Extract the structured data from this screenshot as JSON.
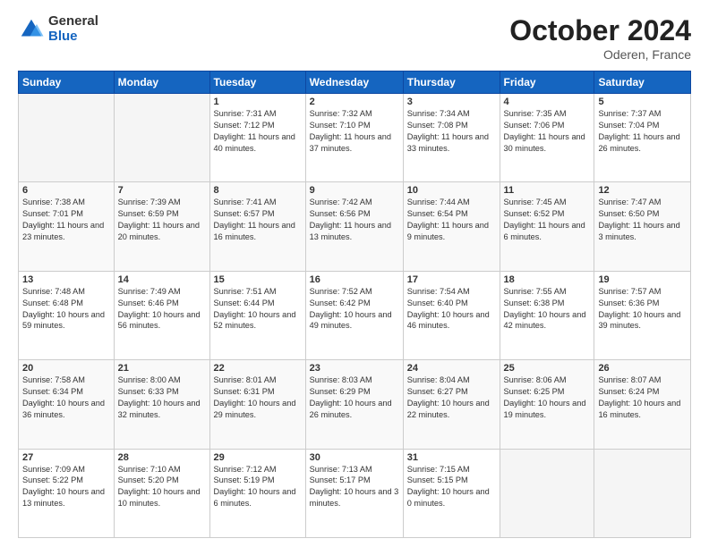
{
  "logo": {
    "general": "General",
    "blue": "Blue"
  },
  "header": {
    "month": "October 2024",
    "location": "Oderen, France"
  },
  "weekdays": [
    "Sunday",
    "Monday",
    "Tuesday",
    "Wednesday",
    "Thursday",
    "Friday",
    "Saturday"
  ],
  "weeks": [
    [
      {
        "day": "",
        "info": ""
      },
      {
        "day": "",
        "info": ""
      },
      {
        "day": "1",
        "info": "Sunrise: 7:31 AM\nSunset: 7:12 PM\nDaylight: 11 hours and 40 minutes."
      },
      {
        "day": "2",
        "info": "Sunrise: 7:32 AM\nSunset: 7:10 PM\nDaylight: 11 hours and 37 minutes."
      },
      {
        "day": "3",
        "info": "Sunrise: 7:34 AM\nSunset: 7:08 PM\nDaylight: 11 hours and 33 minutes."
      },
      {
        "day": "4",
        "info": "Sunrise: 7:35 AM\nSunset: 7:06 PM\nDaylight: 11 hours and 30 minutes."
      },
      {
        "day": "5",
        "info": "Sunrise: 7:37 AM\nSunset: 7:04 PM\nDaylight: 11 hours and 26 minutes."
      }
    ],
    [
      {
        "day": "6",
        "info": "Sunrise: 7:38 AM\nSunset: 7:01 PM\nDaylight: 11 hours and 23 minutes."
      },
      {
        "day": "7",
        "info": "Sunrise: 7:39 AM\nSunset: 6:59 PM\nDaylight: 11 hours and 20 minutes."
      },
      {
        "day": "8",
        "info": "Sunrise: 7:41 AM\nSunset: 6:57 PM\nDaylight: 11 hours and 16 minutes."
      },
      {
        "day": "9",
        "info": "Sunrise: 7:42 AM\nSunset: 6:56 PM\nDaylight: 11 hours and 13 minutes."
      },
      {
        "day": "10",
        "info": "Sunrise: 7:44 AM\nSunset: 6:54 PM\nDaylight: 11 hours and 9 minutes."
      },
      {
        "day": "11",
        "info": "Sunrise: 7:45 AM\nSunset: 6:52 PM\nDaylight: 11 hours and 6 minutes."
      },
      {
        "day": "12",
        "info": "Sunrise: 7:47 AM\nSunset: 6:50 PM\nDaylight: 11 hours and 3 minutes."
      }
    ],
    [
      {
        "day": "13",
        "info": "Sunrise: 7:48 AM\nSunset: 6:48 PM\nDaylight: 10 hours and 59 minutes."
      },
      {
        "day": "14",
        "info": "Sunrise: 7:49 AM\nSunset: 6:46 PM\nDaylight: 10 hours and 56 minutes."
      },
      {
        "day": "15",
        "info": "Sunrise: 7:51 AM\nSunset: 6:44 PM\nDaylight: 10 hours and 52 minutes."
      },
      {
        "day": "16",
        "info": "Sunrise: 7:52 AM\nSunset: 6:42 PM\nDaylight: 10 hours and 49 minutes."
      },
      {
        "day": "17",
        "info": "Sunrise: 7:54 AM\nSunset: 6:40 PM\nDaylight: 10 hours and 46 minutes."
      },
      {
        "day": "18",
        "info": "Sunrise: 7:55 AM\nSunset: 6:38 PM\nDaylight: 10 hours and 42 minutes."
      },
      {
        "day": "19",
        "info": "Sunrise: 7:57 AM\nSunset: 6:36 PM\nDaylight: 10 hours and 39 minutes."
      }
    ],
    [
      {
        "day": "20",
        "info": "Sunrise: 7:58 AM\nSunset: 6:34 PM\nDaylight: 10 hours and 36 minutes."
      },
      {
        "day": "21",
        "info": "Sunrise: 8:00 AM\nSunset: 6:33 PM\nDaylight: 10 hours and 32 minutes."
      },
      {
        "day": "22",
        "info": "Sunrise: 8:01 AM\nSunset: 6:31 PM\nDaylight: 10 hours and 29 minutes."
      },
      {
        "day": "23",
        "info": "Sunrise: 8:03 AM\nSunset: 6:29 PM\nDaylight: 10 hours and 26 minutes."
      },
      {
        "day": "24",
        "info": "Sunrise: 8:04 AM\nSunset: 6:27 PM\nDaylight: 10 hours and 22 minutes."
      },
      {
        "day": "25",
        "info": "Sunrise: 8:06 AM\nSunset: 6:25 PM\nDaylight: 10 hours and 19 minutes."
      },
      {
        "day": "26",
        "info": "Sunrise: 8:07 AM\nSunset: 6:24 PM\nDaylight: 10 hours and 16 minutes."
      }
    ],
    [
      {
        "day": "27",
        "info": "Sunrise: 7:09 AM\nSunset: 5:22 PM\nDaylight: 10 hours and 13 minutes."
      },
      {
        "day": "28",
        "info": "Sunrise: 7:10 AM\nSunset: 5:20 PM\nDaylight: 10 hours and 10 minutes."
      },
      {
        "day": "29",
        "info": "Sunrise: 7:12 AM\nSunset: 5:19 PM\nDaylight: 10 hours and 6 minutes."
      },
      {
        "day": "30",
        "info": "Sunrise: 7:13 AM\nSunset: 5:17 PM\nDaylight: 10 hours and 3 minutes."
      },
      {
        "day": "31",
        "info": "Sunrise: 7:15 AM\nSunset: 5:15 PM\nDaylight: 10 hours and 0 minutes."
      },
      {
        "day": "",
        "info": ""
      },
      {
        "day": "",
        "info": ""
      }
    ]
  ]
}
